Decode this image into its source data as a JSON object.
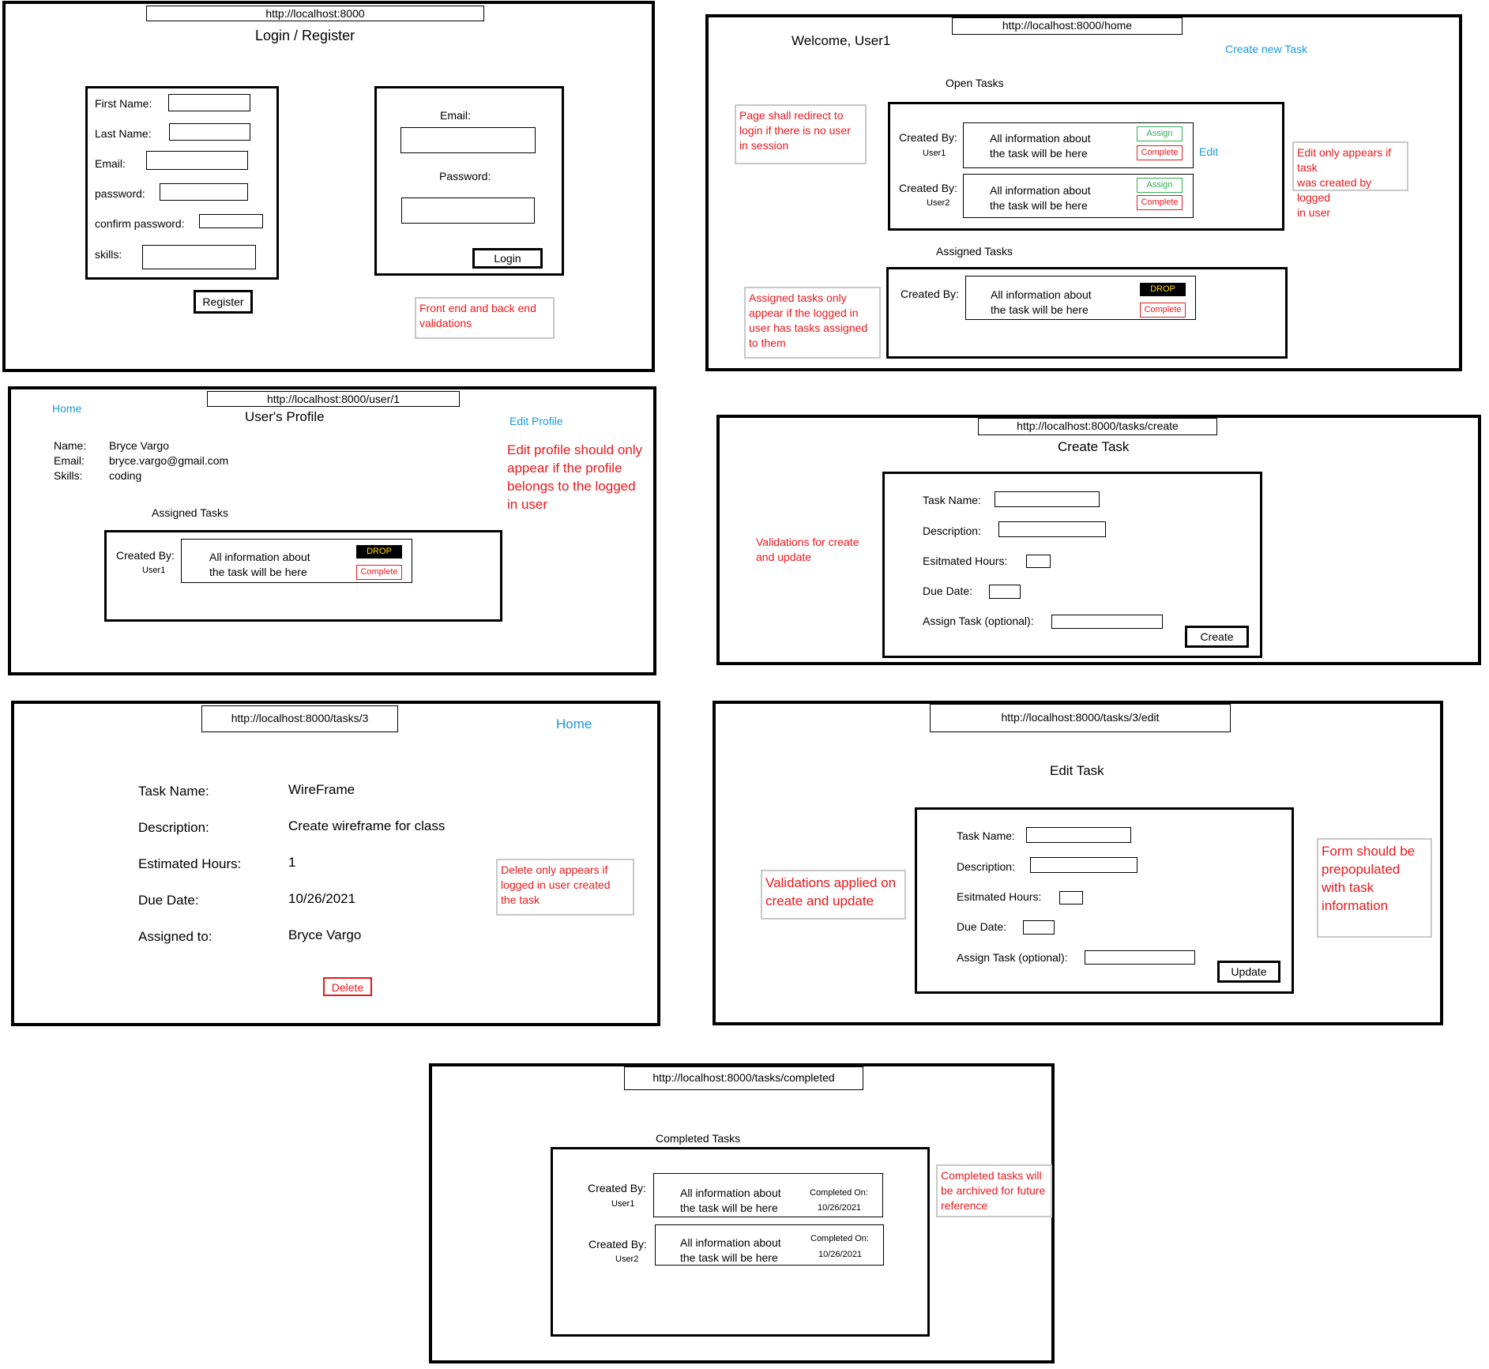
{
  "login": {
    "url": "http://localhost:8000",
    "title": "Login / Register",
    "register": {
      "fields": [
        "First Name:",
        "Last Name:",
        "Email:",
        "password:",
        "confirm password:",
        "skills:"
      ],
      "button": "Register"
    },
    "login_form": {
      "email_label": "Email:",
      "password_label": "Password:",
      "button": "Login"
    },
    "note": "Front end and back end\nvalidations"
  },
  "home": {
    "url": "http://localhost:8000/home",
    "welcome": "Welcome, User1",
    "create_link": "Create new Task",
    "open_tasks_title": "Open Tasks",
    "open_tasks": [
      {
        "created_by": "Created By:",
        "user": "User1",
        "info": "All information about\nthe task will be here",
        "assign": "Assign",
        "complete": "Complete"
      },
      {
        "created_by": "Created By:",
        "user": "User2",
        "info": "All information about\nthe task will be here",
        "assign": "Assign",
        "complete": "Complete"
      }
    ],
    "edit_link": "Edit",
    "assigned_title": "Assigned Tasks",
    "assigned_task": {
      "created_by": "Created By:",
      "info": "All information about\nthe task will be here",
      "drop": "DROP",
      "complete": "Complete"
    },
    "note_redirect": "Page shall redirect to\nlogin if there is no user\nin session",
    "note_edit": "Edit only appears if task\nwas created by logged\nin user",
    "note_assigned": "Assigned tasks only\nappear if the logged in\nuser has tasks assigned\nto them"
  },
  "profile": {
    "url": "http://localhost:8000/user/1",
    "home_link": "Home",
    "title": "User's Profile",
    "edit_link": "Edit Profile",
    "labels": [
      "Name:",
      "Email:",
      "Skills:"
    ],
    "values": [
      "Bryce Vargo",
      "bryce.vargo@gmail.com",
      "coding"
    ],
    "assigned_title": "Assigned Tasks",
    "task": {
      "created_by": "Created By:",
      "user": "User1",
      "info": "All information about\nthe task will be here",
      "drop": "DROP",
      "complete": "Complete"
    },
    "note": "Edit profile should only\nappear if the profile\nbelongs to the logged\nin user"
  },
  "create": {
    "url": "http://localhost:8000/tasks/create",
    "title": "Create Task",
    "fields": [
      "Task Name:",
      "Description:",
      "Esitmated Hours:",
      "Due Date:",
      "Assign Task (optional):"
    ],
    "button": "Create",
    "note": "Validations for create\nand update"
  },
  "show": {
    "url": "http://localhost:8000/tasks/3",
    "home_link": "Home",
    "labels": [
      "Task Name:",
      "Description:",
      "Estimated Hours:",
      "Due Date:",
      "Assigned to:"
    ],
    "values": [
      "WireFrame",
      "Create wireframe for class",
      "1",
      "10/26/2021",
      "Bryce Vargo"
    ],
    "delete": "Delete",
    "note": "Delete only appears if\nlogged in user created\nthe task"
  },
  "edit": {
    "url": "http://localhost:8000/tasks/3/edit",
    "title": "Edit Task",
    "fields": [
      "Task Name:",
      "Description:",
      "Esitmated Hours:",
      "Due Date:",
      "Assign Task (optional):"
    ],
    "button": "Update",
    "note_validation": "Validations applied on\ncreate and update",
    "note_prepopulate": "Form should be\nprepopulated\nwith task\ninformation"
  },
  "completed": {
    "url": "http://localhost:8000/tasks/completed",
    "title": "Completed Tasks",
    "tasks": [
      {
        "created_by": "Created By:",
        "user": "User1",
        "info": "All information about\nthe task will be here",
        "completed_label": "Completed On:",
        "date": "10/26/2021"
      },
      {
        "created_by": "Created By:",
        "user": "User2",
        "info": "All information about\nthe task will be here",
        "completed_label": "Completed On:",
        "date": "10/26/2021"
      }
    ],
    "note": "Completed tasks will\nbe archived for future\nreference"
  },
  "colors": {
    "note_red": "#e8191e",
    "link_blue": "#1a9ad6",
    "assign_green": "#33aa55",
    "drop_yellow": "#ffd800"
  }
}
